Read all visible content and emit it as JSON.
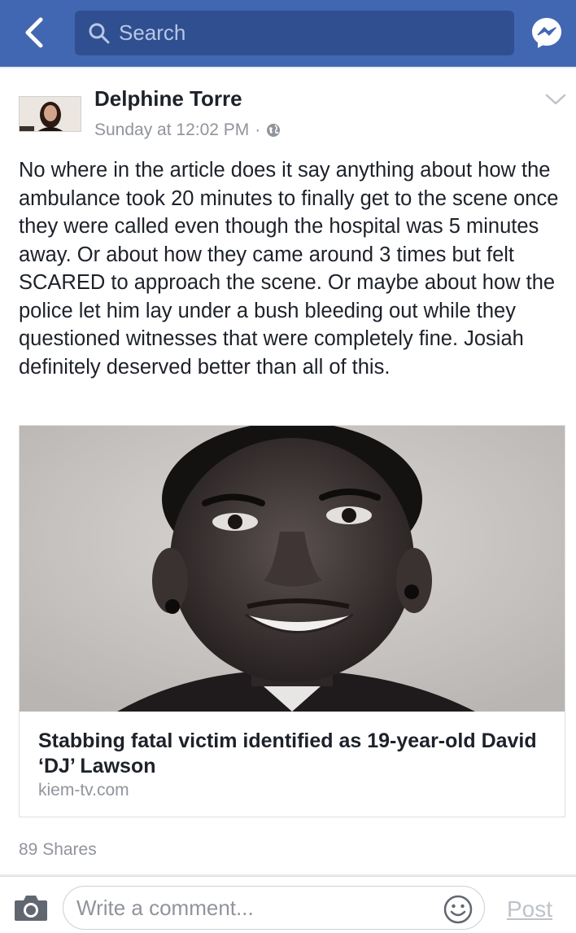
{
  "header": {
    "search_placeholder": "Search",
    "back_icon": "back-arrow-icon",
    "messenger_icon": "messenger-icon",
    "bar_color": "#4267b2"
  },
  "post": {
    "author": "Delphine Torre",
    "timestamp": "Sunday at 12:02 PM",
    "separator": "·",
    "privacy_icon": "globe-icon",
    "text": "No where in the article does it say anything about how the ambulance took 20 minutes to finally get to the scene once they were called even though the hospital was 5 minutes away. Or about how they came around 3 times but felt SCARED to approach the scene. Or maybe about how the police let him lay under a bush bleeding out while they questioned witnesses that were completely fine. Josiah definitely deserved better than all of this.",
    "link": {
      "title": "Stabbing fatal victim identified as 19-year-old David ‘DJ’ Lawson",
      "domain": "kiem-tv.com"
    },
    "shares": "89 Shares"
  },
  "comment_bar": {
    "placeholder": "Write a comment...",
    "post_label": "Post",
    "camera_icon": "camera-icon",
    "emoji_icon": "smiley-icon"
  }
}
